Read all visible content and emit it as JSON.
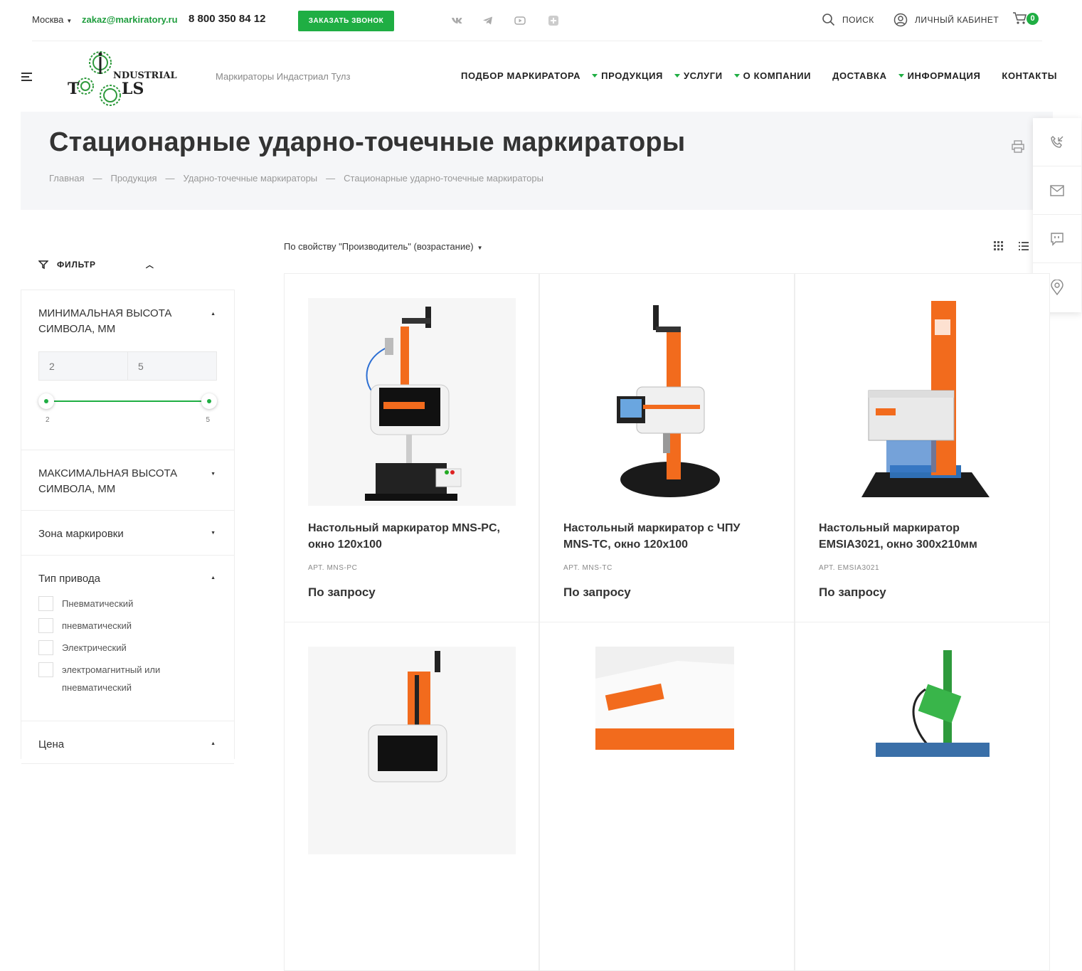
{
  "topbar": {
    "city": "Москва",
    "email": "zakaz@markiratory.ru",
    "phone": "8 800 350 84 12",
    "callback": "ЗАКАЗАТЬ ЗВОНОК",
    "search": "ПОИСК",
    "cabinet": "ЛИЧНЫЙ КАБИНЕТ",
    "cart_count": "0",
    "social": [
      "vk-icon",
      "telegram-icon",
      "youtube-icon",
      "rutube-icon"
    ]
  },
  "header": {
    "logo_text_top": "NDUSTRIAL",
    "logo_text_bottom": "LS",
    "tagline": "Маркираторы Индастриал Тулз",
    "nav": [
      {
        "label": "ПОДБОР МАРКИРАТОРА",
        "dropdown": false
      },
      {
        "label": "ПРОДУКЦИЯ",
        "dropdown": true
      },
      {
        "label": "УСЛУГИ",
        "dropdown": true
      },
      {
        "label": "О КОМПАНИИ",
        "dropdown": true
      },
      {
        "label": "ДОСТАВКА",
        "dropdown": false
      },
      {
        "label": "ИНФОРМАЦИЯ",
        "dropdown": true
      },
      {
        "label": "КОНТАКТЫ",
        "dropdown": false
      }
    ]
  },
  "page": {
    "title": "Стационарные ударно-точечные маркираторы",
    "breadcrumbs": [
      "Главная",
      "Продукция",
      "Ударно-точечные маркираторы",
      "Стационарные ударно-точечные маркираторы"
    ]
  },
  "filter": {
    "title": "ФИЛЬТР",
    "min_height": {
      "title": "МИНИМАЛЬНАЯ ВЫСОТА СИМВОЛА, ММ",
      "from": "2",
      "to": "5",
      "min_label": "2",
      "max_label": "5"
    },
    "max_height": {
      "title": "МАКСИМАЛЬНАЯ ВЫСОТА СИМВОЛА, ММ"
    },
    "zone": {
      "title": "Зона маркировки"
    },
    "drive": {
      "title": "Тип привода",
      "options": [
        "Пневматический",
        "пневматический",
        "Электрический",
        "электромагнитный или пневматический"
      ]
    },
    "price": {
      "title": "Цена"
    }
  },
  "sort": {
    "label": "По свойству \"Производитель\" (возрастание)"
  },
  "products": [
    {
      "name": "Настольный маркиратор MNS-PC, окно 120х100",
      "art": "АРТ. MNS-PC",
      "price": "По запросу"
    },
    {
      "name": "Настольный маркиратор с ЧПУ MNS-TC, окно 120х100",
      "art": "АРТ. MNS-TC",
      "price": "По запросу"
    },
    {
      "name": "Настольный маркиратор EMSIA3021, окно 300х210мм",
      "art": "АРТ. EMSIA3021",
      "price": "По запросу"
    }
  ],
  "colors": {
    "accent": "#1fae43",
    "orange": "#f26b1d"
  }
}
